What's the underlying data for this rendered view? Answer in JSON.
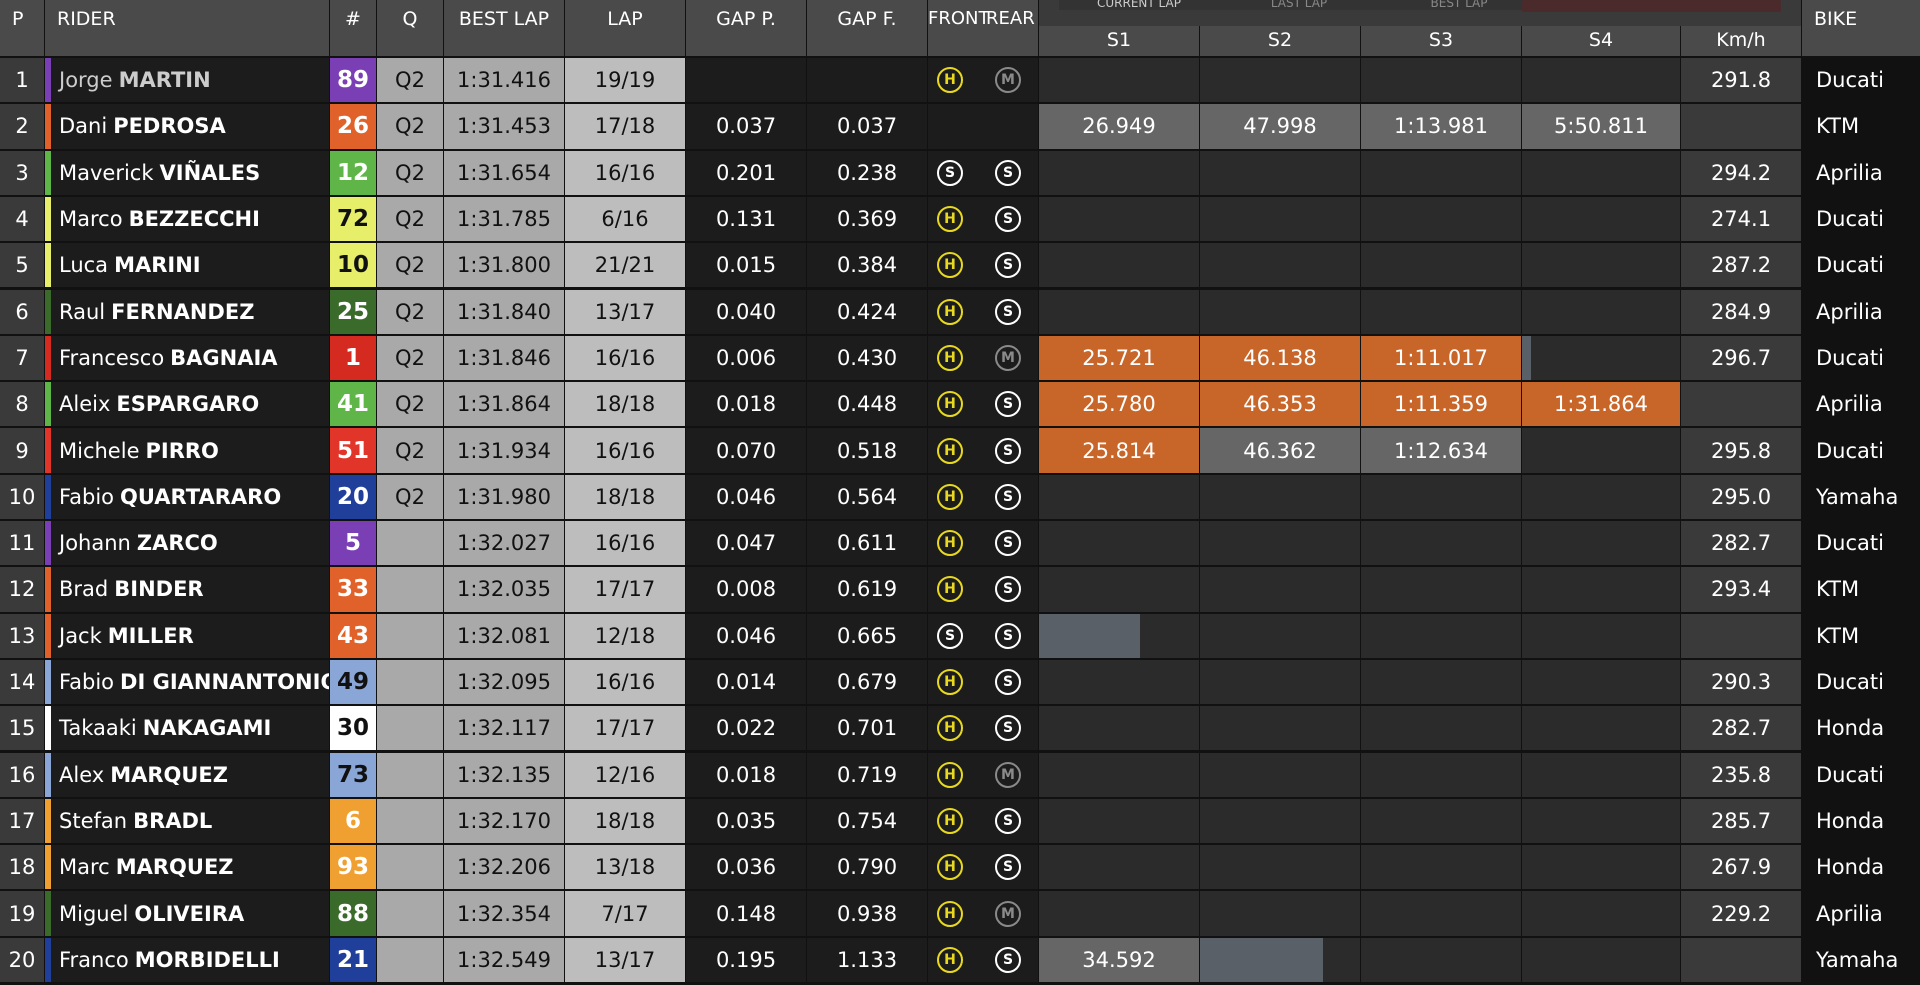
{
  "header": {
    "p": "P",
    "rider": "RIDER",
    "number": "#",
    "q": "Q",
    "best_lap": "BEST LAP",
    "lap": "LAP",
    "gap_p": "GAP P.",
    "gap_f": "GAP F.",
    "front": "FRONT",
    "rear": "REAR",
    "s1": "S1",
    "s2": "S2",
    "s3": "S3",
    "s4": "S4",
    "speed": "Km/h",
    "bike": "BIKE",
    "view_tabs": [
      "CURRENT LAP",
      "LAST LAP",
      "BEST LAP"
    ]
  },
  "colors": {
    "orange": "#c8662a",
    "grey": "#666666",
    "slate": "#5a6068"
  },
  "rows": [
    {
      "pos": "1",
      "first": "Jorge",
      "last": "MARTIN",
      "num": "89",
      "team_color": "#7a3fb5",
      "num_bg": "#7a3fb5",
      "num_fg": "#ffffff",
      "q": "Q2",
      "best": "1:31.416",
      "lap": "19/19",
      "gap_p": "",
      "gap_f": "",
      "front": "H",
      "rear": "M",
      "sectors": [],
      "speed": "291.8",
      "bike": "Ducati"
    },
    {
      "pos": "2",
      "first": "Dani",
      "last": "PEDROSA",
      "num": "26",
      "team_color": "#e0622a",
      "num_bg": "#e0622a",
      "num_fg": "#ffffff",
      "q": "Q2",
      "best": "1:31.453",
      "lap": "17/18",
      "gap_p": "0.037",
      "gap_f": "0.037",
      "front": "",
      "rear": "",
      "sectors": [
        {
          "s": 1,
          "v": "26.949",
          "c": "grey"
        },
        {
          "s": 2,
          "v": "47.998",
          "c": "grey"
        },
        {
          "s": 3,
          "v": "1:13.981",
          "c": "grey"
        },
        {
          "s": 4,
          "v": "5:50.811",
          "c": "grey"
        }
      ],
      "speed": "",
      "bike": "KTM"
    },
    {
      "pos": "3",
      "first": "Maverick",
      "last": "VIÑALES",
      "num": "12",
      "team_color": "#5fb548",
      "num_bg": "#5fb548",
      "num_fg": "#ffffff",
      "q": "Q2",
      "best": "1:31.654",
      "lap": "16/16",
      "gap_p": "0.201",
      "gap_f": "0.238",
      "front": "S",
      "rear": "S",
      "sectors": [],
      "speed": "294.2",
      "bike": "Aprilia"
    },
    {
      "pos": "4",
      "first": "Marco",
      "last": "BEZZECCHI",
      "num": "72",
      "team_color": "#e6ee6a",
      "num_bg": "#e6ee6a",
      "num_fg": "#111111",
      "q": "Q2",
      "best": "1:31.785",
      "lap": "6/16",
      "gap_p": "0.131",
      "gap_f": "0.369",
      "front": "H",
      "rear": "S",
      "sectors": [],
      "speed": "274.1",
      "bike": "Ducati"
    },
    {
      "pos": "5",
      "first": "Luca",
      "last": "MARINI",
      "num": "10",
      "team_color": "#e6ee6a",
      "num_bg": "#e6ee6a",
      "num_fg": "#111111",
      "q": "Q2",
      "best": "1:31.800",
      "lap": "21/21",
      "gap_p": "0.015",
      "gap_f": "0.384",
      "front": "H",
      "rear": "S",
      "sectors": [],
      "speed": "287.2",
      "bike": "Ducati"
    },
    {
      "pos": "6",
      "first": "Raul",
      "last": "FERNANDEZ",
      "num": "25",
      "team_color": "#3a6b2a",
      "num_bg": "#3a6b2a",
      "num_fg": "#ffffff",
      "q": "Q2",
      "best": "1:31.840",
      "lap": "13/17",
      "gap_p": "0.040",
      "gap_f": "0.424",
      "front": "H",
      "rear": "S",
      "sectors": [],
      "speed": "284.9",
      "bike": "Aprilia"
    },
    {
      "pos": "7",
      "first": "Francesco",
      "last": "BAGNAIA",
      "num": "1",
      "team_color": "#d42a20",
      "num_bg": "#d42a20",
      "num_fg": "#ffffff",
      "q": "Q2",
      "best": "1:31.846",
      "lap": "16/16",
      "gap_p": "0.006",
      "gap_f": "0.430",
      "front": "H",
      "rear": "M",
      "sectors": [
        {
          "s": 1,
          "v": "25.721",
          "c": "orange"
        },
        {
          "s": 2,
          "v": "46.138",
          "c": "orange"
        },
        {
          "s": 3,
          "v": "1:11.017",
          "c": "orange"
        },
        {
          "s": 4,
          "v": "",
          "c": "slate",
          "fill": 0.06
        }
      ],
      "speed": "296.7",
      "bike": "Ducati"
    },
    {
      "pos": "8",
      "first": "Aleix",
      "last": "ESPARGARO",
      "num": "41",
      "team_color": "#5fb548",
      "num_bg": "#5fb548",
      "num_fg": "#ffffff",
      "q": "Q2",
      "best": "1:31.864",
      "lap": "18/18",
      "gap_p": "0.018",
      "gap_f": "0.448",
      "front": "H",
      "rear": "S",
      "sectors": [
        {
          "s": 1,
          "v": "25.780",
          "c": "orange"
        },
        {
          "s": 2,
          "v": "46.353",
          "c": "orange"
        },
        {
          "s": 3,
          "v": "1:11.359",
          "c": "orange"
        },
        {
          "s": 4,
          "v": "1:31.864",
          "c": "orange"
        }
      ],
      "speed": "",
      "bike": "Aprilia"
    },
    {
      "pos": "9",
      "first": "Michele",
      "last": "PIRRO",
      "num": "51",
      "team_color": "#e2352a",
      "num_bg": "#e2352a",
      "num_fg": "#ffffff",
      "q": "Q2",
      "best": "1:31.934",
      "lap": "16/16",
      "gap_p": "0.070",
      "gap_f": "0.518",
      "front": "H",
      "rear": "S",
      "sectors": [
        {
          "s": 1,
          "v": "25.814",
          "c": "orange"
        },
        {
          "s": 2,
          "v": "46.362",
          "c": "grey"
        },
        {
          "s": 3,
          "v": "1:12.634",
          "c": "grey"
        }
      ],
      "speed": "295.8",
      "bike": "Ducati"
    },
    {
      "pos": "10",
      "first": "Fabio",
      "last": "QUARTARARO",
      "num": "20",
      "team_color": "#1f3f9a",
      "num_bg": "#1f3f9a",
      "num_fg": "#ffffff",
      "q": "Q2",
      "best": "1:31.980",
      "lap": "18/18",
      "gap_p": "0.046",
      "gap_f": "0.564",
      "front": "H",
      "rear": "S",
      "sectors": [],
      "speed": "295.0",
      "bike": "Yamaha"
    },
    {
      "pos": "11",
      "first": "Johann",
      "last": "ZARCO",
      "num": "5",
      "team_color": "#7a3fb5",
      "num_bg": "#7a3fb5",
      "num_fg": "#ffffff",
      "q": "",
      "best": "1:32.027",
      "lap": "16/16",
      "gap_p": "0.047",
      "gap_f": "0.611",
      "front": "H",
      "rear": "S",
      "sectors": [],
      "speed": "282.7",
      "bike": "Ducati"
    },
    {
      "pos": "12",
      "first": "Brad",
      "last": "BINDER",
      "num": "33",
      "team_color": "#e0622a",
      "num_bg": "#e0622a",
      "num_fg": "#ffffff",
      "q": "",
      "best": "1:32.035",
      "lap": "17/17",
      "gap_p": "0.008",
      "gap_f": "0.619",
      "front": "H",
      "rear": "S",
      "sectors": [],
      "speed": "293.4",
      "bike": "KTM"
    },
    {
      "pos": "13",
      "first": "Jack",
      "last": "MILLER",
      "num": "43",
      "team_color": "#e0622a",
      "num_bg": "#e0622a",
      "num_fg": "#ffffff",
      "q": "",
      "best": "1:32.081",
      "lap": "12/18",
      "gap_p": "0.046",
      "gap_f": "0.665",
      "front": "S",
      "rear": "S",
      "sectors": [
        {
          "s": 1,
          "v": "",
          "c": "slate",
          "fill": 0.63
        }
      ],
      "speed": "",
      "bike": "KTM"
    },
    {
      "pos": "14",
      "first": "Fabio",
      "last": "DI GIANNANTONIO",
      "num": "49",
      "team_color": "#8aa6d6",
      "num_bg": "#8aa6d6",
      "num_fg": "#111111",
      "q": "",
      "best": "1:32.095",
      "lap": "16/16",
      "gap_p": "0.014",
      "gap_f": "0.679",
      "front": "H",
      "rear": "S",
      "sectors": [],
      "speed": "290.3",
      "bike": "Ducati"
    },
    {
      "pos": "15",
      "first": "Takaaki",
      "last": "NAKAGAMI",
      "num": "30",
      "team_color": "#ffffff",
      "num_bg": "#ffffff",
      "num_fg": "#111111",
      "q": "",
      "best": "1:32.117",
      "lap": "17/17",
      "gap_p": "0.022",
      "gap_f": "0.701",
      "front": "H",
      "rear": "S",
      "sectors": [],
      "speed": "282.7",
      "bike": "Honda"
    },
    {
      "pos": "16",
      "first": "Alex",
      "last": "MARQUEZ",
      "num": "73",
      "team_color": "#8aa6d6",
      "num_bg": "#8aa6d6",
      "num_fg": "#111111",
      "q": "",
      "best": "1:32.135",
      "lap": "12/16",
      "gap_p": "0.018",
      "gap_f": "0.719",
      "front": "H",
      "rear": "M",
      "sectors": [],
      "speed": "235.8",
      "bike": "Ducati"
    },
    {
      "pos": "17",
      "first": "Stefan",
      "last": "BRADL",
      "num": "6",
      "team_color": "#f0a030",
      "num_bg": "#f0a030",
      "num_fg": "#ffffff",
      "q": "",
      "best": "1:32.170",
      "lap": "18/18",
      "gap_p": "0.035",
      "gap_f": "0.754",
      "front": "H",
      "rear": "S",
      "sectors": [],
      "speed": "285.7",
      "bike": "Honda"
    },
    {
      "pos": "18",
      "first": "Marc",
      "last": "MARQUEZ",
      "num": "93",
      "team_color": "#f0a030",
      "num_bg": "#f0a030",
      "num_fg": "#ffffff",
      "q": "",
      "best": "1:32.206",
      "lap": "13/18",
      "gap_p": "0.036",
      "gap_f": "0.790",
      "front": "H",
      "rear": "S",
      "sectors": [],
      "speed": "267.9",
      "bike": "Honda"
    },
    {
      "pos": "19",
      "first": "Miguel",
      "last": "OLIVEIRA",
      "num": "88",
      "team_color": "#3a6b2a",
      "num_bg": "#3a6b2a",
      "num_fg": "#ffffff",
      "q": "",
      "best": "1:32.354",
      "lap": "7/17",
      "gap_p": "0.148",
      "gap_f": "0.938",
      "front": "H",
      "rear": "M",
      "sectors": [],
      "speed": "229.2",
      "bike": "Aprilia"
    },
    {
      "pos": "20",
      "first": "Franco",
      "last": "MORBIDELLI",
      "num": "21",
      "team_color": "#1f3f9a",
      "num_bg": "#1f3f9a",
      "num_fg": "#ffffff",
      "q": "",
      "best": "1:32.549",
      "lap": "13/17",
      "gap_p": "0.195",
      "gap_f": "1.133",
      "front": "H",
      "rear": "S",
      "sectors": [
        {
          "s": 1,
          "v": "34.592",
          "c": "grey"
        },
        {
          "s": 2,
          "v": "",
          "c": "slate",
          "fill": 0.77
        }
      ],
      "speed": "",
      "bike": "Yamaha"
    }
  ]
}
